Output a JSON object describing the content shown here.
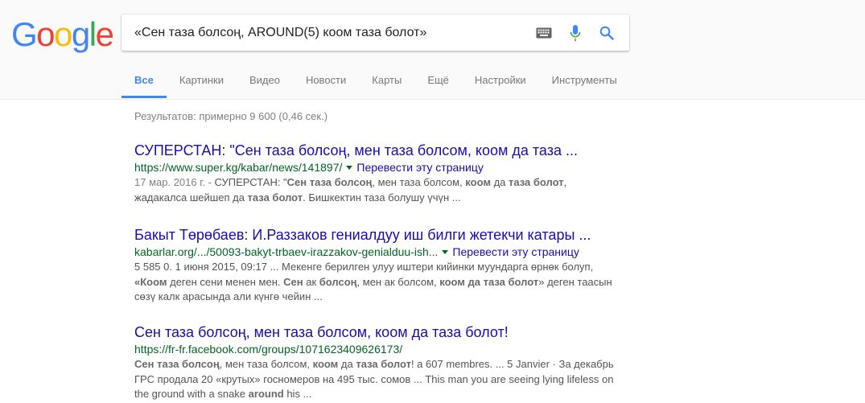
{
  "logo": {
    "letters": [
      "G",
      "o",
      "o",
      "g",
      "l",
      "e"
    ],
    "colors": [
      "#4285f4",
      "#ea4335",
      "#fbbc05",
      "#4285f4",
      "#34a853",
      "#ea4335"
    ]
  },
  "search": {
    "query": "«Сен таза болсоң, AROUND(5) коом таза болот»",
    "icons": [
      "keyboard-icon",
      "mic-icon",
      "search-icon"
    ]
  },
  "tabs": [
    "Все",
    "Картинки",
    "Видео",
    "Новости",
    "Карты",
    "Ещё",
    "Настройки",
    "Инструменты"
  ],
  "active_tab": "Все",
  "stats": "Результатов: примерно 9 600 (0,46 сек.)",
  "results": [
    {
      "title": "СУПЕРСТАН: \"Сен таза болсоң, мен таза болсом, коом да таза ...",
      "url": "https://www.super.kg/kabar/news/141897/",
      "translate": "Перевести эту страницу",
      "snippet": [
        [
          {
            "t": "17 мар. 2016 г. - ",
            "s": "date"
          },
          {
            "t": "СУПЕРСТАН: \"",
            "s": ""
          },
          {
            "t": "Сен таза болсоң",
            "s": "b"
          },
          {
            "t": ", мен таза болсом, ",
            "s": ""
          },
          {
            "t": "коом",
            "s": "b"
          },
          {
            "t": " да ",
            "s": ""
          },
          {
            "t": "таза болот",
            "s": "b"
          },
          {
            "t": ",",
            "s": ""
          }
        ],
        [
          {
            "t": "жадакалса шейшеп да ",
            "s": ""
          },
          {
            "t": "таза болот",
            "s": "b"
          },
          {
            "t": ". Бишкектин таза болушу үчүн ...",
            "s": ""
          }
        ]
      ]
    },
    {
      "title": "Бакыт Төрөбаев: И.Раззаков гениалдуу иш билги жетекчи катары ...",
      "url": "kabarlar.org/.../50093-bakyt-trbaev-irazzakov-genialduu-ish...",
      "translate": "Перевести эту страницу",
      "snippet": [
        [
          {
            "t": "5 585 0. 1 июня 2015, 09:17 ... Мекенге берилген улуу иштери кийинки муундарга өрнөк болуп,",
            "s": ""
          }
        ],
        [
          {
            "t": "«Коом",
            "s": "b"
          },
          {
            "t": " деген сени менен мен. ",
            "s": ""
          },
          {
            "t": "Сен",
            "s": "b"
          },
          {
            "t": " ак ",
            "s": ""
          },
          {
            "t": "болсоң",
            "s": "b"
          },
          {
            "t": ", мен ак болсом, ",
            "s": ""
          },
          {
            "t": "коом да таза болот",
            "s": "b"
          },
          {
            "t": "» деген таасын",
            "s": ""
          }
        ],
        [
          {
            "t": "сөзү калк арасында али күнгө чейин ...",
            "s": ""
          }
        ]
      ]
    },
    {
      "title": "Сен таза болсоң, мен таза болсом, коом да таза болот!",
      "url": "https://fr-fr.facebook.com/groups/1071623409626173/",
      "translate": "",
      "snippet": [
        [
          {
            "t": "Сен таза болсоң",
            "s": "b"
          },
          {
            "t": ", мен таза болсом, ",
            "s": ""
          },
          {
            "t": "коом",
            "s": "b"
          },
          {
            "t": " да ",
            "s": ""
          },
          {
            "t": "таза болот",
            "s": "b"
          },
          {
            "t": "! a 607 membres. ... 5 Janvier · За декабрь",
            "s": ""
          }
        ],
        [
          {
            "t": "ГРС продала 20 «крутых» госномеров на 495 тыс. сомов ... This man you are seeing lying lifeless on",
            "s": ""
          }
        ],
        [
          {
            "t": "the ground with a snake ",
            "s": ""
          },
          {
            "t": "around",
            "s": "b"
          },
          {
            "t": " his ...",
            "s": ""
          }
        ]
      ]
    }
  ]
}
